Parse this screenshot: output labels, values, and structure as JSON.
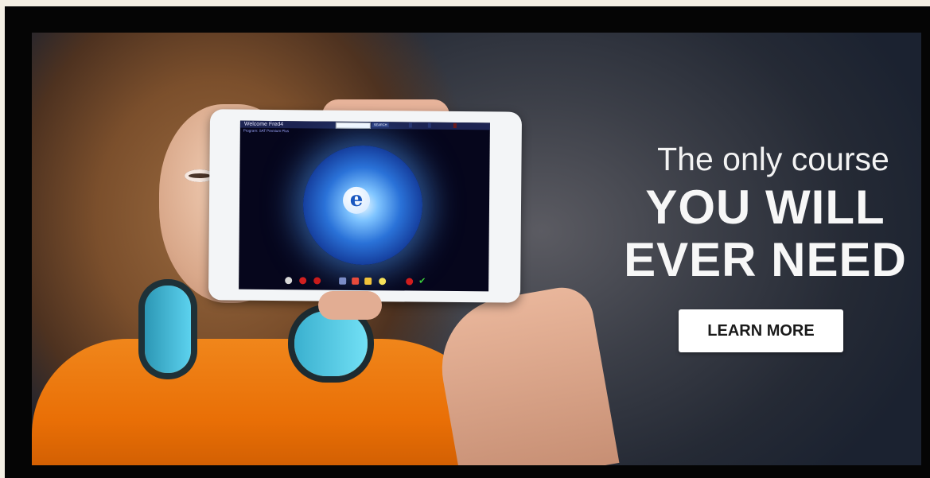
{
  "banner": {
    "headline_top": "The only course",
    "headline_line1": "YOU WILL",
    "headline_line2": "EVER NEED",
    "cta_label": "LEARN MORE"
  },
  "tablet": {
    "welcome": "Welcome Fred4",
    "search_button": "SEARCH",
    "program_label": "Program: SAT Premium Plus",
    "logo_letter": "e"
  },
  "colors": {
    "cta_background": "#ffffff",
    "shirt": "#e96f06",
    "headphones": "#4cc3e3",
    "globe": "#2a72d8"
  }
}
